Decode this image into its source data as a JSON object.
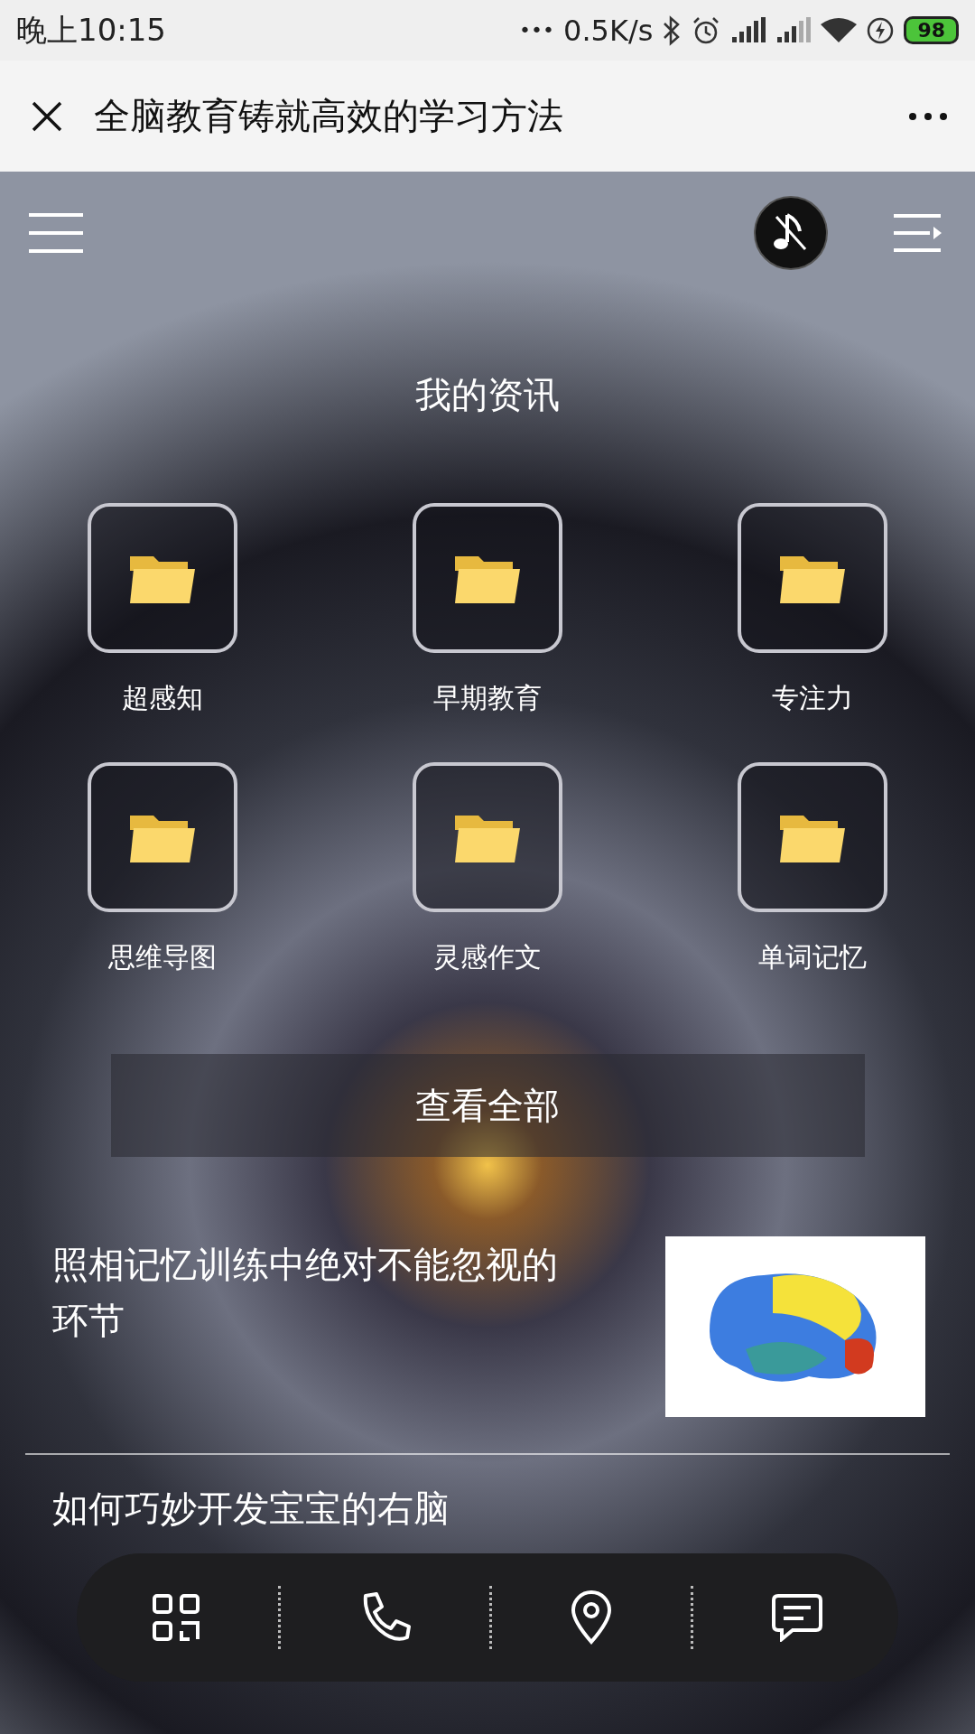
{
  "status_bar": {
    "time": "晚上10:15",
    "dots": "•••",
    "speed": "0.5K/s",
    "battery": "98"
  },
  "title_bar": {
    "title": "全脑教育铸就高效的学习方法"
  },
  "section": {
    "title": "我的资讯",
    "folders": [
      {
        "label": "超感知"
      },
      {
        "label": "早期教育"
      },
      {
        "label": "专注力"
      },
      {
        "label": "思维导图"
      },
      {
        "label": "灵感作文"
      },
      {
        "label": "单词记忆"
      }
    ],
    "view_all": "查看全部"
  },
  "articles": [
    {
      "title": "照相记忆训练中绝对不能忽视的环节",
      "has_image": true
    },
    {
      "title": "如何巧妙开发宝宝的右脑",
      "has_image": false
    }
  ]
}
